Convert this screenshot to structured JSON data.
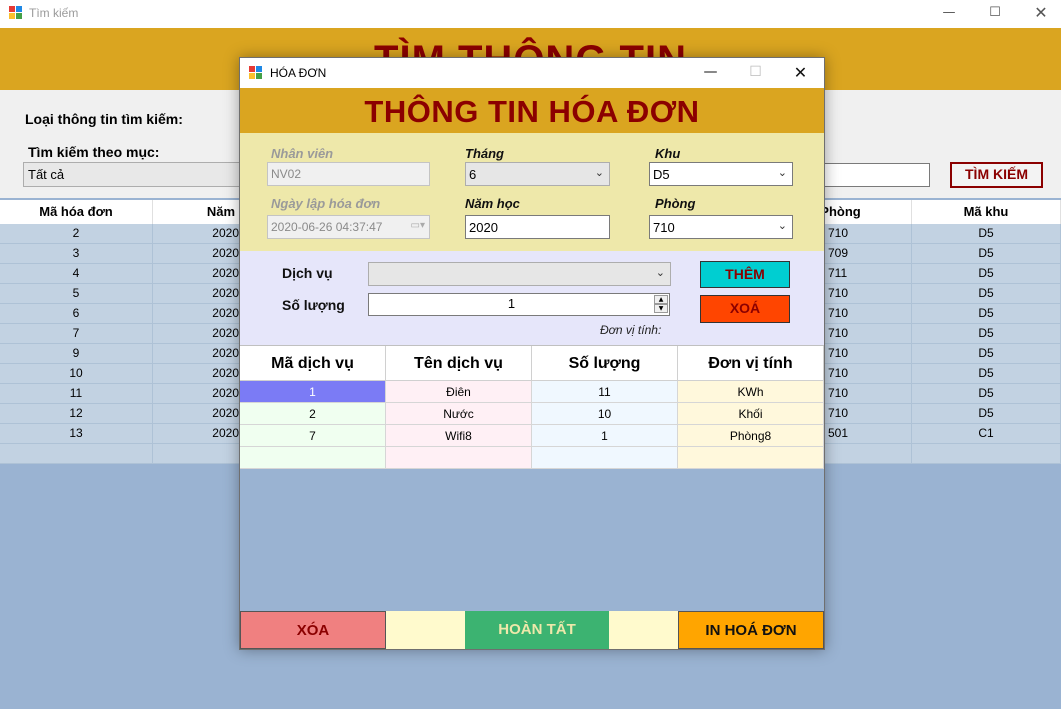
{
  "main_window": {
    "title": "Tìm kiếm",
    "header_title": "TÌM THÔNG TIN",
    "search_type_label": "Loại thông tin tìm kiếm:",
    "search_by_label": "Tìm kiếm theo mục:",
    "search_by_value": "Tất cả",
    "search_text": "",
    "search_button": "TÌM KIẾM",
    "grid": {
      "columns": [
        "Mã hóa đơn",
        "Năm",
        "Phòng",
        "Mã khu"
      ],
      "rows": [
        [
          "2",
          "2020",
          "710",
          "D5"
        ],
        [
          "3",
          "2020",
          "709",
          "D5"
        ],
        [
          "4",
          "2020",
          "711",
          "D5"
        ],
        [
          "5",
          "2020",
          "710",
          "D5"
        ],
        [
          "6",
          "2020",
          "710",
          "D5"
        ],
        [
          "7",
          "2020",
          "710",
          "D5"
        ],
        [
          "9",
          "2020",
          "710",
          "D5"
        ],
        [
          "10",
          "2020",
          "710",
          "D5"
        ],
        [
          "11",
          "2020",
          "710",
          "D5"
        ],
        [
          "12",
          "2020",
          "710",
          "D5"
        ],
        [
          "13",
          "2020",
          "501",
          "C1"
        ],
        [
          "",
          "",
          "",
          ""
        ]
      ]
    }
  },
  "dialog": {
    "title": "HÓA ĐƠN",
    "header_title": "THÔNG TIN HÓA ĐƠN",
    "fields": {
      "nhan_vien_label": "Nhân viên",
      "nhan_vien_value": "NV02",
      "thang_label": "Tháng",
      "thang_value": "6",
      "khu_label": "Khu",
      "khu_value": "D5",
      "ngay_lap_label": "Ngày lập hóa đơn",
      "ngay_lap_value": "2020-06-26 04:37:47",
      "nam_hoc_label": "Năm học",
      "nam_hoc_value": "2020",
      "phong_label": "Phòng",
      "phong_value": "710"
    },
    "service": {
      "dich_vu_label": "Dịch vụ",
      "dich_vu_value": "",
      "so_luong_label": "Số lượng",
      "so_luong_value": "1",
      "don_vi_label": "Đơn vị tính:",
      "them_button": "THÊM",
      "xoa_button": "XOÁ"
    },
    "detail_grid": {
      "columns": [
        "Mã dịch vụ",
        "Tên dịch vụ",
        "Số lượng",
        "Đơn vị tính"
      ],
      "rows": [
        [
          "1",
          "Điên",
          "11",
          "KWh"
        ],
        [
          "2",
          "Nước",
          "10",
          "Khối"
        ],
        [
          "7",
          "Wifi8",
          "1",
          "Phòng8"
        ],
        [
          "",
          "",
          "",
          ""
        ]
      ]
    },
    "buttons": {
      "xoa": "XÓA",
      "hoan_tat": "HOÀN TẤT",
      "in_hoa_don": "IN HOÁ ĐƠN"
    }
  },
  "colors": {
    "header_gold": "#daa520",
    "title_darkred": "#8b0000",
    "info_panel": "#eee8aa",
    "service_panel": "#e6e6fa",
    "them_button": "#00ced1",
    "xoa_small_button": "#ff4500",
    "xoa_button": "#f08080",
    "hoan_tat_button": "#3cb371",
    "in_hoa_don_button": "#ffa500",
    "grid_background": "#9ab3d2"
  }
}
